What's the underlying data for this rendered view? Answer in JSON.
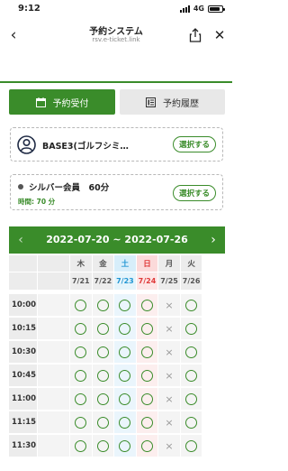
{
  "status_bar": {
    "time": "9:12",
    "network": "4G",
    "battery_level": 0.85
  },
  "nav": {
    "title": "予約システム",
    "url": "rsv.e-ticket.link",
    "back_icon": "chevron-left-icon",
    "share_icon": "share-icon",
    "close_icon": "close-icon"
  },
  "tabs": [
    {
      "label": "予約受付",
      "icon": "calendar-icon",
      "active": true
    },
    {
      "label": "予約履歴",
      "icon": "history-list-icon",
      "active": false
    }
  ],
  "resource_card": {
    "name": "BASE3(ゴルフシミ…",
    "button_label": "選択する",
    "icon": "user-icon"
  },
  "course_card": {
    "name": "シルバー会員　60分",
    "duration": "時間: 70 分",
    "button_label": "選択する"
  },
  "week": {
    "range": "2022-07-20 ~ 2022-07-26",
    "prev_icon": "chevron-left-icon",
    "next_icon": "chevron-right-icon"
  },
  "colors": {
    "accent": "#3a8c2a",
    "saturday": "#2196d3",
    "sunday": "#e03a3a"
  },
  "calendar": {
    "days": [
      {
        "weekday": "木",
        "date": "7/21",
        "type": "weekday"
      },
      {
        "weekday": "金",
        "date": "7/22",
        "type": "weekday"
      },
      {
        "weekday": "土",
        "date": "7/23",
        "type": "sat"
      },
      {
        "weekday": "日",
        "date": "7/24",
        "type": "sun"
      },
      {
        "weekday": "月",
        "date": "7/25",
        "type": "weekday"
      },
      {
        "weekday": "火",
        "date": "7/26",
        "type": "weekday"
      }
    ],
    "slots": [
      {
        "time": "10:00",
        "availability": [
          "○",
          "○",
          "○",
          "○",
          "×",
          "○"
        ]
      },
      {
        "time": "10:15",
        "availability": [
          "○",
          "○",
          "○",
          "○",
          "×",
          "○"
        ]
      },
      {
        "time": "10:30",
        "availability": [
          "○",
          "○",
          "○",
          "○",
          "×",
          "○"
        ]
      },
      {
        "time": "10:45",
        "availability": [
          "○",
          "○",
          "○",
          "○",
          "×",
          "○"
        ]
      },
      {
        "time": "11:00",
        "availability": [
          "○",
          "○",
          "○",
          "○",
          "×",
          "○"
        ]
      },
      {
        "time": "11:15",
        "availability": [
          "○",
          "○",
          "○",
          "○",
          "×",
          "○"
        ]
      },
      {
        "time": "11:30",
        "availability": [
          "○",
          "○",
          "○",
          "○",
          "×",
          "○"
        ]
      }
    ]
  }
}
